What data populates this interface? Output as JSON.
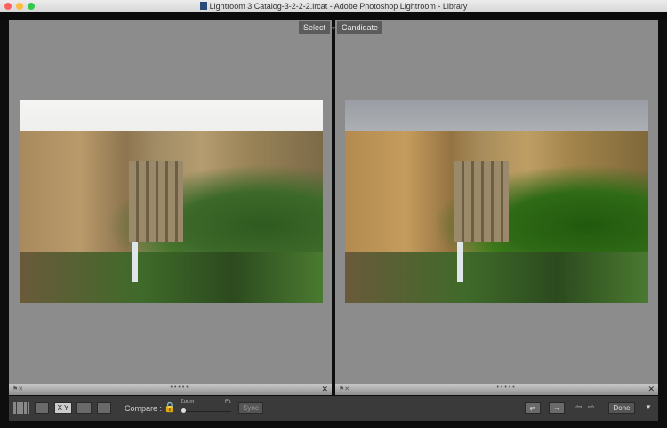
{
  "window": {
    "title": "Lightroom 3 Catalog-3-2-2-2.lrcat - Adobe Photoshop Lightroom - Library"
  },
  "panels": {
    "select_label": "Select",
    "candidate_label": "Candidate"
  },
  "toolbar": {
    "compare_label": "Compare :",
    "zoom_label": "Zoom",
    "fit_label": "Fit",
    "sync_label": "Sync",
    "done_label": "Done",
    "xy_label": "X Y",
    "zoom_level": 0
  },
  "colors": {
    "panel_bg": "#8c8c8c",
    "toolbar_bg": "#3a3a3a"
  }
}
